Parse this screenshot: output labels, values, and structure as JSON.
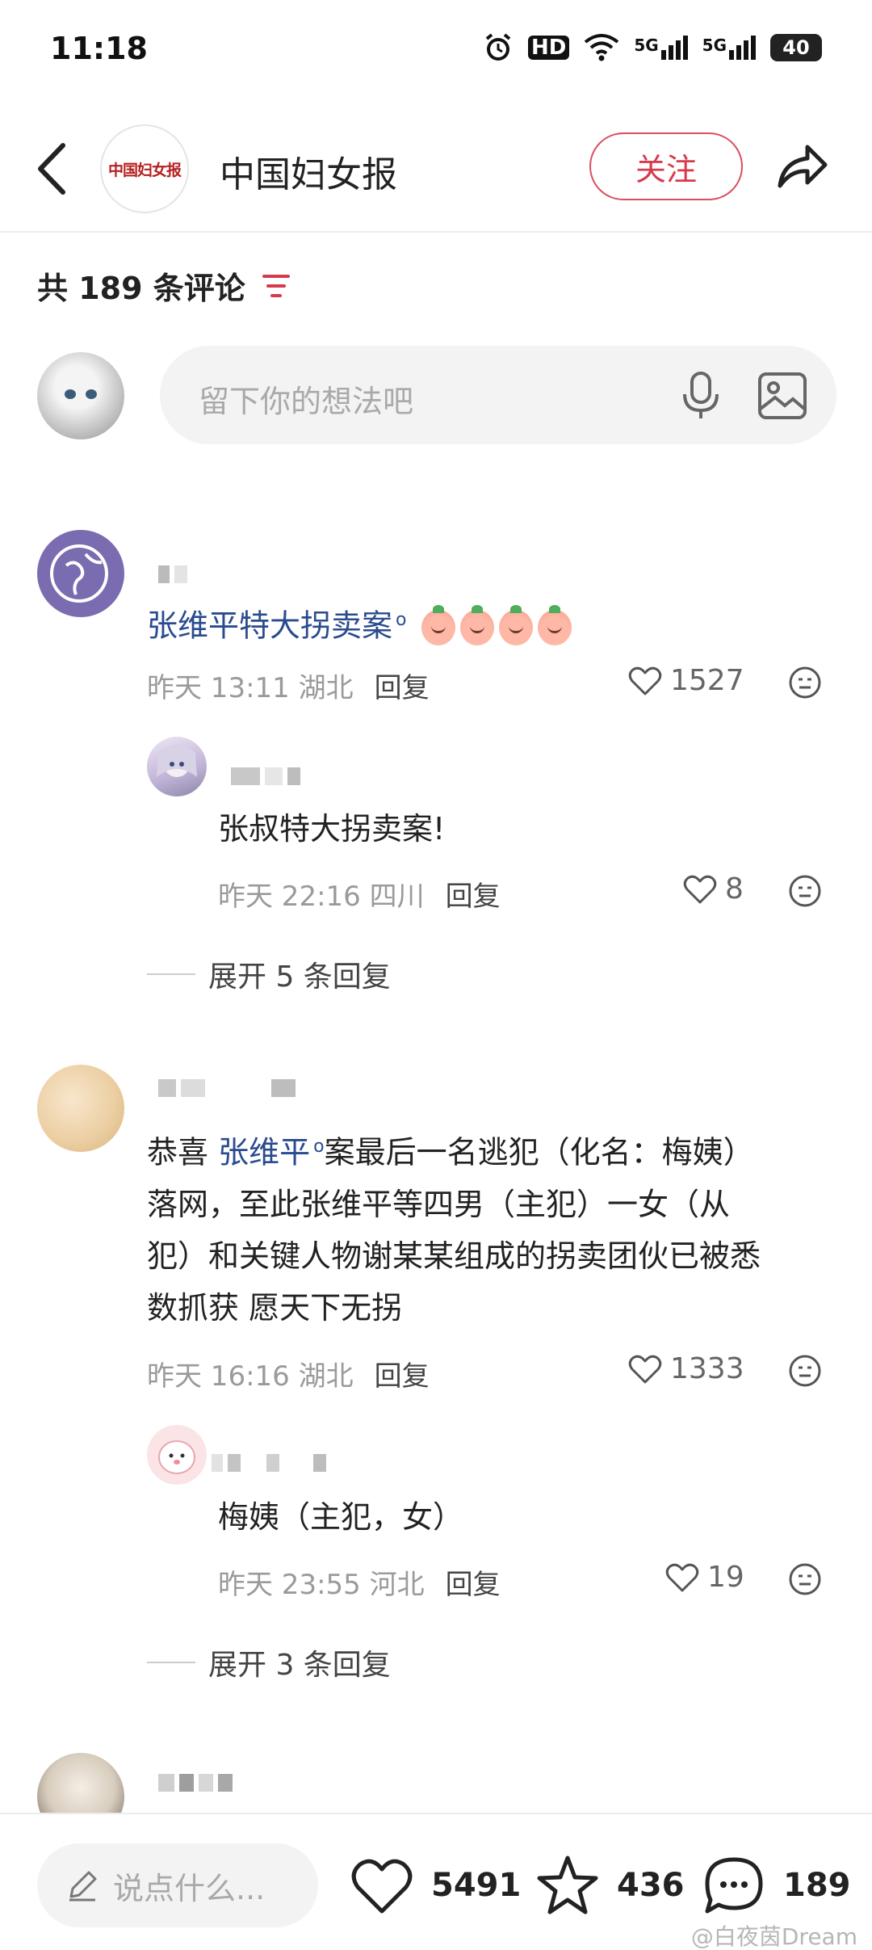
{
  "status_bar": {
    "time": "11:18",
    "icons": [
      "alarm-icon",
      "hd-icon",
      "wifi-icon",
      "5g-signal-icon",
      "5g-signal-icon",
      "battery-icon"
    ],
    "hd_label": "HD",
    "signal1_label": "5G",
    "signal2_label": "5G",
    "battery_level": "40"
  },
  "header": {
    "title": "中国妇女报",
    "logo_text": "中国妇女报",
    "follow_label": "关注",
    "accent_color": "#d63a4c"
  },
  "comments_section": {
    "count_label": "共 189 条评论"
  },
  "composer": {
    "placeholder": "留下你的想法吧"
  },
  "comments": [
    {
      "link_text": "张维平特大拐卖案",
      "time": "昨天 13:11",
      "location": "湖北",
      "reply_label": "回复",
      "likes": "1527",
      "replies": [
        {
          "text": "张叔特大拐卖案!",
          "time": "昨天 22:16",
          "location": "四川",
          "reply_label": "回复",
          "likes": "8"
        }
      ],
      "expand_label": "展开 5 条回复"
    },
    {
      "text_prefix": "恭喜 ",
      "link_text": "张维平",
      "text_line1": "案最后一名逃犯（化名：梅姨）",
      "text_line2": "落网，至此张维平等四男（主犯）一女（从",
      "text_line3": "犯）和关键人物谢某某组成的拐卖团伙已被悉",
      "text_line4": "数抓获 愿天下无拐",
      "time": "昨天 16:16",
      "location": "湖北",
      "reply_label": "回复",
      "likes": "1333",
      "replies": [
        {
          "text": "梅姨（主犯，女）",
          "time": "昨天 23:55",
          "location": "河北",
          "reply_label": "回复",
          "likes": "19"
        }
      ],
      "expand_label": "展开 3 条回复"
    }
  ],
  "bottom_bar": {
    "say_placeholder": "说点什么...",
    "likes": "5491",
    "favorites": "436",
    "comments": "189"
  },
  "watermark": "@白夜茵Dream"
}
